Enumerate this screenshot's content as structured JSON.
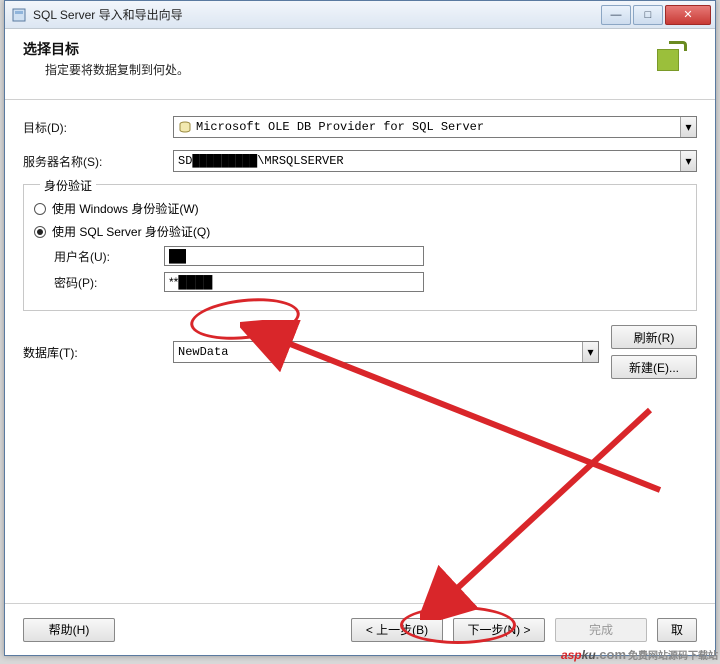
{
  "window": {
    "title": "SQL Server 导入和导出向导"
  },
  "header": {
    "title": "选择目标",
    "subtitle": "指定要将数据复制到何处。"
  },
  "labels": {
    "target": "目标(D):",
    "server": "服务器名称(S):",
    "auth_legend": "身份验证",
    "auth_windows": "使用 Windows 身份验证(W)",
    "auth_sql": "使用 SQL Server 身份验证(Q)",
    "username": "用户名(U):",
    "password": "密码(P):",
    "database": "数据库(T):"
  },
  "values": {
    "target": "Microsoft OLE DB Provider for SQL Server",
    "server": "SD█████████\\MRSQLSERVER",
    "username": "██",
    "password": "**████",
    "database": "NewData"
  },
  "buttons": {
    "refresh": "刷新(R)",
    "new": "新建(E)...",
    "help": "帮助(H)",
    "back": "< 上一步(B)",
    "next": "下一步(N) >",
    "finish": "完成",
    "cancel": "取"
  },
  "watermark": {
    "a": "asp",
    "b": "ku",
    "c": ".com",
    "d": "免费网站源码下载站"
  }
}
